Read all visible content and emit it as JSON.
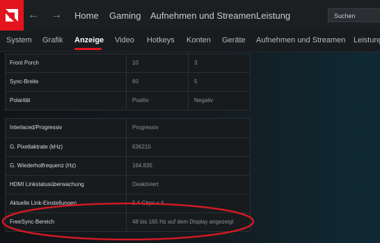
{
  "topbar": {
    "nav": [
      "Home",
      "Gaming",
      "Aufnehmen und Streamen",
      "Leistung"
    ],
    "search_placeholder": "Suchen"
  },
  "subnav": {
    "tabs": [
      "System",
      "Grafik",
      "Anzeige",
      "Video",
      "Hotkeys",
      "Konten",
      "Geräte",
      "Aufnehmen und Streamen",
      "Leistung"
    ],
    "active": "Anzeige"
  },
  "table1": {
    "rows": [
      {
        "label": "Front Porch",
        "v1": "10",
        "v2": "3"
      },
      {
        "label": "Sync-Breite",
        "v1": "60",
        "v2": "5"
      },
      {
        "label": "Polarität",
        "v1": "Positiv",
        "v2": "Negativ"
      }
    ]
  },
  "table2": {
    "rows": [
      {
        "label": "Interlaced/Progressiv",
        "value": "Progressiv"
      },
      {
        "label": "G. Pixeltaktrate (kHz)",
        "value": "636210"
      },
      {
        "label": "G. Wiederholfrequenz (Hz)",
        "value": "164.835"
      },
      {
        "label": "HDMI Linkstatusüberwachung",
        "value": "Deaktiviert"
      },
      {
        "label": "Aktuelle Link-Einstellungen",
        "value": "5.4 Gbps x 4"
      },
      {
        "label": "FreeSync-Bereich",
        "value": "48 bis 165 Hz auf dem Display angezeigt"
      }
    ]
  },
  "colors": {
    "accent": "#e3141e",
    "highlight_ellipse": "#d11a22"
  }
}
